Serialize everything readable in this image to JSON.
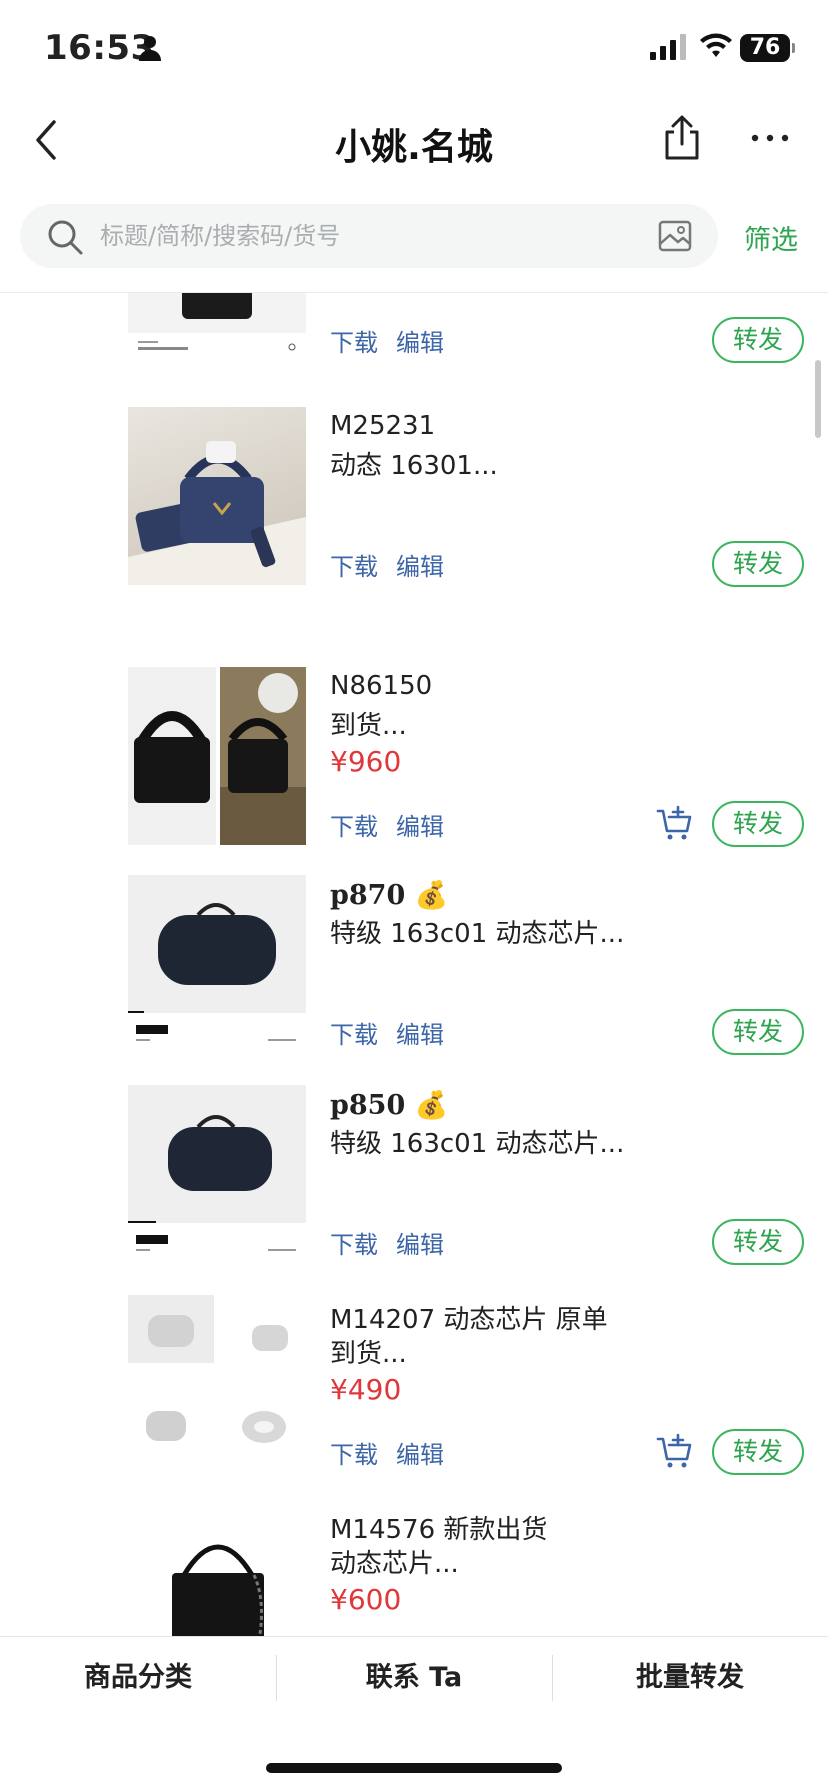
{
  "status_bar": {
    "time": "16:53",
    "battery": "76"
  },
  "nav": {
    "title": "小姚.名城"
  },
  "search": {
    "placeholder": "标题/简称/搜索码/货号",
    "filter_label": "筛选"
  },
  "item_actions": {
    "download": "下载",
    "edit": "编辑",
    "forward": "转发"
  },
  "items": [
    {
      "line1": "",
      "line2": "",
      "price": ""
    },
    {
      "line1": "M25231",
      "line2": "动态 16301...",
      "price": ""
    },
    {
      "line1": "N86150",
      "line2": "到货...",
      "price": "¥960"
    },
    {
      "line1": "p870 💰",
      "line2": "特级 163c01 动态芯片...",
      "price": ""
    },
    {
      "line1": "p850 💰",
      "line2": "特级 163c01 动态芯片...",
      "price": ""
    },
    {
      "line1": "M14207 动态芯片 原单",
      "line2": "到货...",
      "price": "¥490"
    },
    {
      "line1": "M14576 新款出货",
      "line2": "动态芯片...",
      "price": "¥600"
    }
  ],
  "tabbar": {
    "category": "商品分类",
    "contact": "联系 Ta",
    "batch_forward": "批量转发"
  },
  "colors": {
    "accent_green": "#2ea44f",
    "link_blue": "#3c66a8",
    "price_red": "#e0373a"
  }
}
